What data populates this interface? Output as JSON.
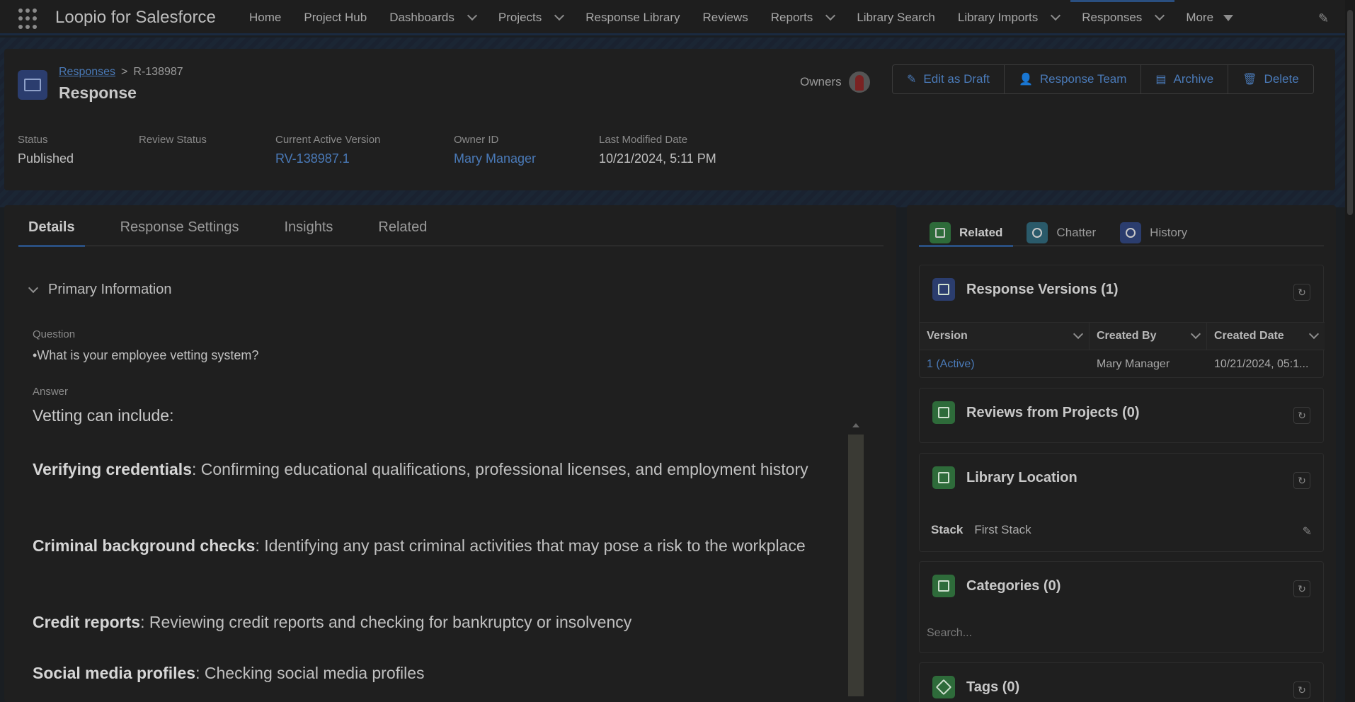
{
  "app": {
    "name": "Loopio for Salesforce"
  },
  "nav": {
    "items": [
      {
        "label": "Home",
        "menu": false
      },
      {
        "label": "Project Hub",
        "menu": false
      },
      {
        "label": "Dashboards",
        "menu": true
      },
      {
        "label": "Projects",
        "menu": true
      },
      {
        "label": "Response Library",
        "menu": false
      },
      {
        "label": "Reviews",
        "menu": false
      },
      {
        "label": "Reports",
        "menu": true
      },
      {
        "label": "Library Search",
        "menu": false
      },
      {
        "label": "Library Imports",
        "menu": true
      },
      {
        "label": "Responses",
        "menu": true,
        "active": true
      },
      {
        "label": "More",
        "menu": "triangle"
      }
    ]
  },
  "record": {
    "breadcrumb_parent": "Responses",
    "breadcrumb_sep": ">",
    "breadcrumb_current": "R-138987",
    "title": "Response",
    "owners_label": "Owners",
    "actions": {
      "edit": "Edit as Draft",
      "team": "Response Team",
      "archive": "Archive",
      "delete": "Delete"
    },
    "fields": {
      "status_label": "Status",
      "status_value": "Published",
      "review_label": "Review Status",
      "review_value": "",
      "version_label": "Current Active Version",
      "version_value": "RV-138987.1",
      "owner_label": "Owner ID",
      "owner_value": "Mary Manager",
      "modified_label": "Last Modified Date",
      "modified_value": "10/21/2024, 5:11 PM"
    }
  },
  "details": {
    "tabs": [
      "Details",
      "Response Settings",
      "Insights",
      "Related"
    ],
    "section_title": "Primary Information",
    "question_label": "Question",
    "question_value": "•What is your employee vetting system?",
    "answer_label": "Answer",
    "answer_intro": "Vetting can include:",
    "answer_items": [
      {
        "term": "Verifying credentials",
        "text": ": Confirming educational qualifications, professional licenses, and employment history"
      },
      {
        "term": "Criminal background checks",
        "text": ": Identifying any past criminal activities that may pose a risk to the workplace"
      },
      {
        "term": "Credit reports",
        "text": ": Reviewing credit reports and checking for bankruptcy or insolvency"
      },
      {
        "term": "Social media profiles",
        "text": ": Checking social media profiles"
      }
    ]
  },
  "side": {
    "tabs": [
      {
        "label": "Related",
        "color": "#2e6b3a"
      },
      {
        "label": "Chatter",
        "color": "#2a5a6a"
      },
      {
        "label": "History",
        "color": "#2b3d6e"
      }
    ],
    "versions": {
      "title": "Response Versions (1)",
      "columns": [
        "Version",
        "Created By",
        "Created Date"
      ],
      "rows": [
        [
          "1 (Active)",
          "Mary Manager",
          "10/21/2024, 05:1..."
        ]
      ]
    },
    "reviews": {
      "title": "Reviews from Projects (0)"
    },
    "library": {
      "title": "Library Location",
      "stack_label": "Stack",
      "stack_value": "First Stack"
    },
    "categories": {
      "title": "Categories (0)",
      "search_placeholder": "Search..."
    },
    "tags": {
      "title": "Tags (0)"
    }
  },
  "colors": {
    "accent": "#4a7ab8",
    "brand_nav": "#2a4f80",
    "green_icon": "#2e6b3a",
    "blue_icon": "#2b3d6e"
  }
}
